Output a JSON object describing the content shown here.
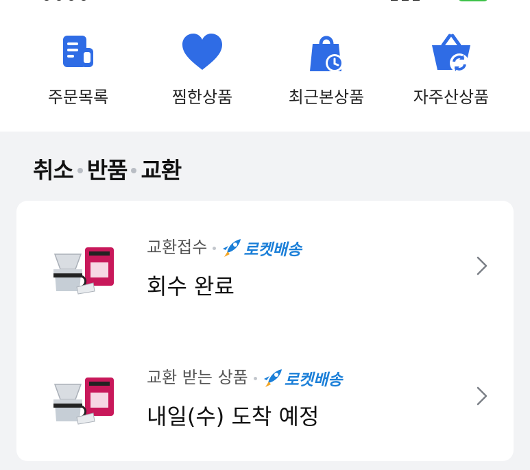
{
  "colors": {
    "icon_blue": "#2f6ce5",
    "rocket_blue": "#1b7fd8",
    "rocket_orange": "#f5a623",
    "page_bg": "#f2f3f5",
    "card_bg": "#ffffff"
  },
  "quick_menu": [
    {
      "label": "주문목록",
      "icon": "receipt-icon"
    },
    {
      "label": "찜한상품",
      "icon": "heart-icon"
    },
    {
      "label": "최근본상품",
      "icon": "shopping-bag-clock-icon"
    },
    {
      "label": "자주산상품",
      "icon": "basket-refresh-icon"
    }
  ],
  "section": {
    "title_parts": [
      "취소",
      "반품",
      "교환"
    ]
  },
  "items": [
    {
      "type_label": "교환접수",
      "delivery_badge": "로켓배송",
      "status": "회수 완료",
      "thumbnail_icon": "coffee-dripper-product-image"
    },
    {
      "type_label": "교환 받는 상품",
      "delivery_badge": "로켓배송",
      "status": "내일(수) 도착 예정",
      "thumbnail_icon": "coffee-dripper-product-image"
    }
  ]
}
